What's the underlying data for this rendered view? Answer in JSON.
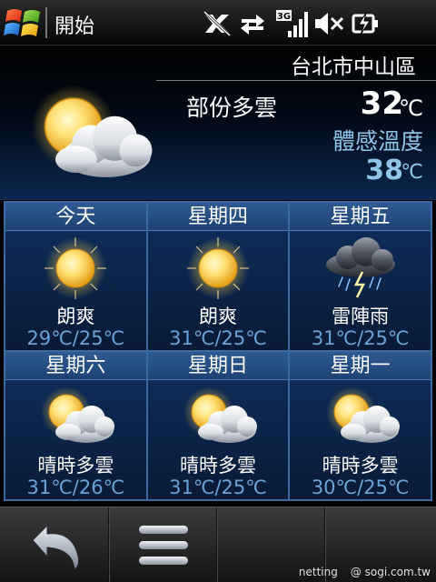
{
  "status_bar": {
    "start_label": "開始",
    "icons": [
      "windows-logo-icon",
      "no-connection-icon",
      "data-transfer-icon",
      "3g-signal-icon",
      "speaker-muted-icon",
      "battery-charging-icon"
    ],
    "signal_badge": "3G"
  },
  "current": {
    "location": "台北市中山區",
    "condition": "部份多雲",
    "temperature": "32",
    "temperature_unit": "℃",
    "feels_like_label": "體感溫度",
    "feels_like": "38",
    "feels_like_unit": "℃",
    "icon": "partly-cloudy-icon"
  },
  "forecast": [
    {
      "day": "今天",
      "condition": "朗爽",
      "range": "29℃/25℃",
      "icon": "sunny-icon"
    },
    {
      "day": "星期四",
      "condition": "朗爽",
      "range": "31℃/25℃",
      "icon": "sunny-icon"
    },
    {
      "day": "星期五",
      "condition": "雷陣雨",
      "range": "31℃/25℃",
      "icon": "thunderstorm-icon"
    },
    {
      "day": "星期六",
      "condition": "晴時多雲",
      "range": "31℃/26℃",
      "icon": "partly-cloudy-icon"
    },
    {
      "day": "星期日",
      "condition": "晴時多雲",
      "range": "31℃/25℃",
      "icon": "partly-cloudy-icon"
    },
    {
      "day": "星期一",
      "condition": "晴時多雲",
      "range": "30℃/25℃",
      "icon": "partly-cloudy-icon"
    }
  ],
  "bottom_bar": {
    "buttons": [
      "back-icon",
      "menu-icon"
    ]
  },
  "watermark": {
    "user": "netting",
    "site": "@ sogi.com.tw"
  },
  "colors": {
    "background": "#000000",
    "panel": "#0b2347",
    "panel_header": "#2e5a92",
    "grid_border": "#3a6aa0",
    "temp_range": "#6aa3d6",
    "feels_like": "#8fc5e8"
  }
}
